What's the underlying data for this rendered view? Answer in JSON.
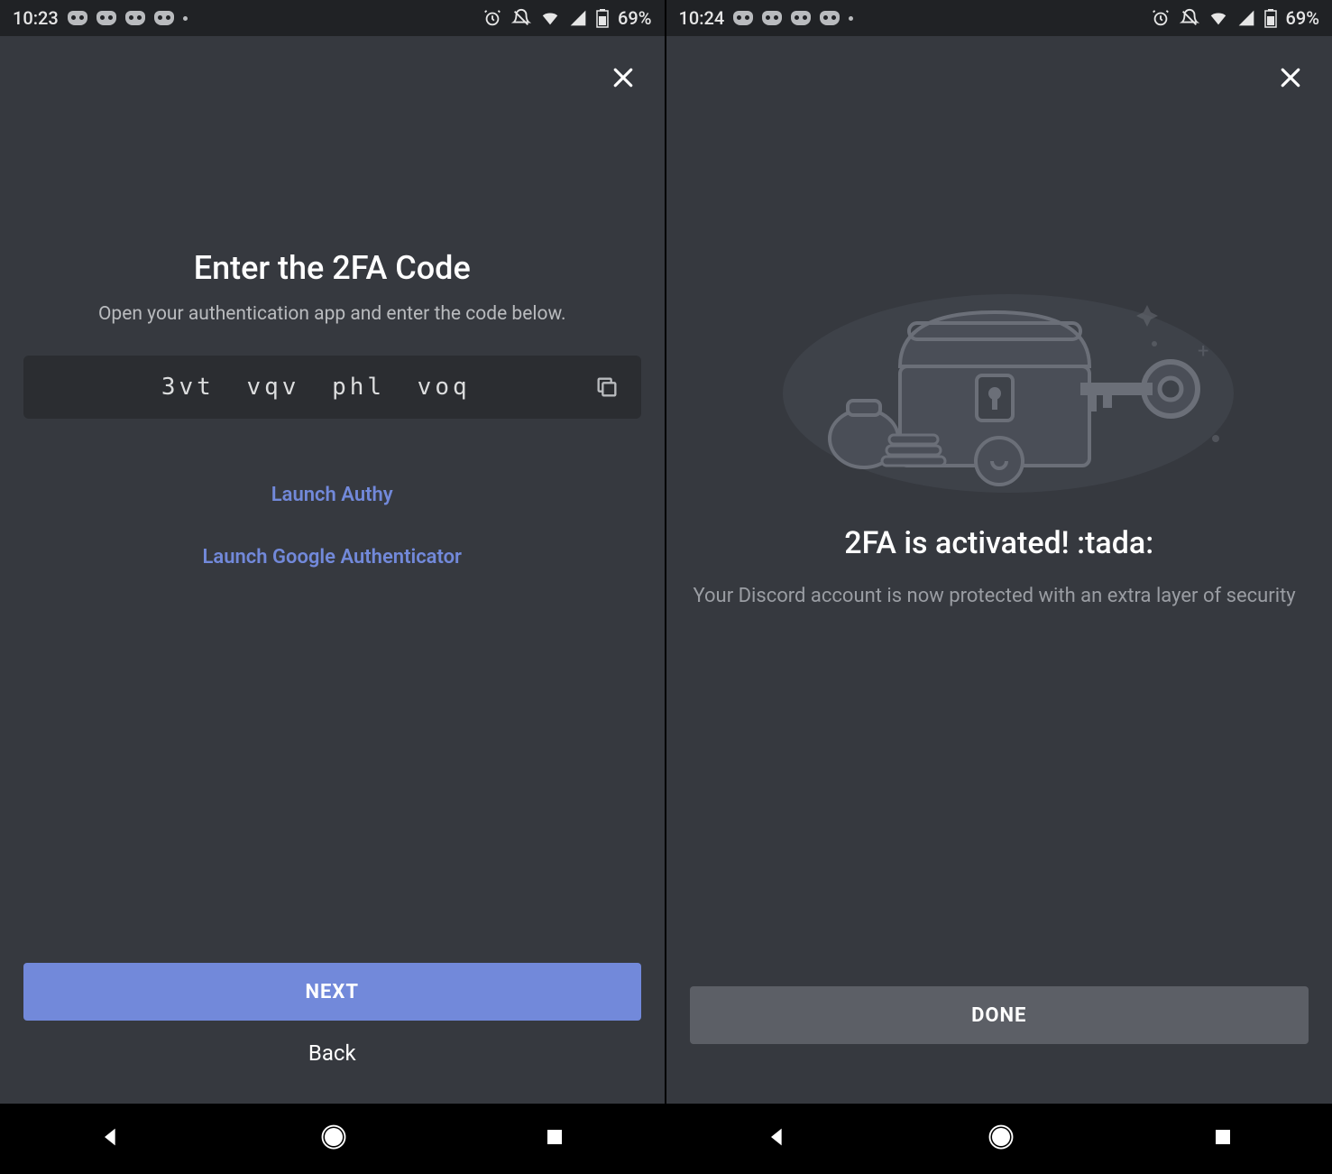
{
  "left": {
    "status": {
      "time": "10:23",
      "battery": "69%"
    },
    "title": "Enter the 2FA Code",
    "subtitle": "Open your authentication app and enter the code below.",
    "code": "3vt vqv phl voq",
    "authy_link": "Launch Authy",
    "google_link": "Launch Google Authenticator",
    "next_label": "NEXT",
    "back_label": "Back"
  },
  "right": {
    "status": {
      "time": "10:24",
      "battery": "69%"
    },
    "title": "2FA is activated! :tada:",
    "desc": "Your Discord account is now protected with an extra layer of security",
    "done_label": "DONE"
  }
}
